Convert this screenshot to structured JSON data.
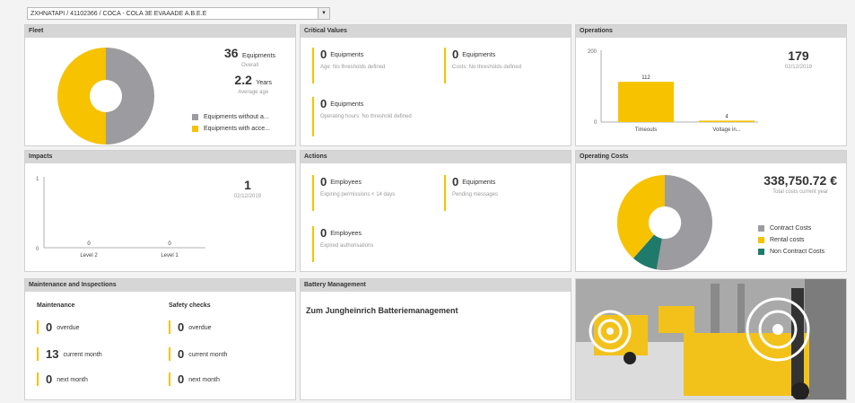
{
  "selector": {
    "value": "ZXHNATAPI / 41102366 / COCA - COLA 3E EVAAADE A.B.E.E"
  },
  "fleet": {
    "title": "Fleet",
    "equipments_count": "36",
    "equipments_unit": "Equipments",
    "equipments_sub": "Overall",
    "age_value": "2.2",
    "age_unit": "Years",
    "age_sub": "Average age",
    "legend": [
      "Equipments without a...",
      "Equipments with acce..."
    ],
    "colors": {
      "gray": "#9b9ba0",
      "yellow": "#f7c200"
    }
  },
  "critical": {
    "title": "Critical Values",
    "k1": {
      "num": "0",
      "unit": "Equipments",
      "sub": "Age: No thresholds defined"
    },
    "k2": {
      "num": "0",
      "unit": "Equipments",
      "sub": "Costs: No thresholds defined"
    },
    "k3": {
      "num": "0",
      "unit": "Equipments",
      "sub": "Operating hours: No threshold defined"
    }
  },
  "operations": {
    "title": "Operations",
    "total": "179",
    "date": "02/12/2019",
    "y_top": "200",
    "y_bottom": "0"
  },
  "chart_data": [
    {
      "type": "bar",
      "categories": [
        "Timeouts",
        "Voltage in..."
      ],
      "values": [
        112,
        4
      ],
      "ylim": [
        0,
        200
      ]
    },
    {
      "type": "bar",
      "categories": [
        "Level 2",
        "Level 1"
      ],
      "values": [
        0,
        0
      ],
      "ylim": [
        0,
        1
      ]
    }
  ],
  "impacts": {
    "title": "Impacts",
    "total": "1",
    "date": "02/12/2019",
    "y_top": "1",
    "y_bottom": "0"
  },
  "actions": {
    "title": "Actions",
    "k1": {
      "num": "0",
      "unit": "Employees",
      "sub": "Expiring permissions < 14 days"
    },
    "k2": {
      "num": "0",
      "unit": "Equipments",
      "sub": "Pending messages"
    },
    "k3": {
      "num": "0",
      "unit": "Employees",
      "sub": "Expired authorisations"
    }
  },
  "costs": {
    "title": "Operating Costs",
    "total": "338,750.72 €",
    "sub": "Total costs current year",
    "legend": [
      "Contract Costs",
      "Rental costs",
      "Non Contract Costs"
    ],
    "colors": {
      "gray": "#9b9ba0",
      "yellow": "#f7c200",
      "teal": "#1f7a6b"
    }
  },
  "maintenance": {
    "title": "Maintenance and Inspections",
    "col1_title": "Maintenance",
    "col2_title": "Safety checks",
    "rows": [
      {
        "m_num": "0",
        "m_label": "overdue",
        "s_num": "0",
        "s_label": "overdue"
      },
      {
        "m_num": "13",
        "m_label": "current month",
        "s_num": "0",
        "s_label": "current month"
      },
      {
        "m_num": "0",
        "m_label": "next month",
        "s_num": "0",
        "s_label": "next month"
      }
    ]
  },
  "battery": {
    "title": "Battery Management",
    "link": "Zum Jungheinrich Batteriemanagement"
  }
}
